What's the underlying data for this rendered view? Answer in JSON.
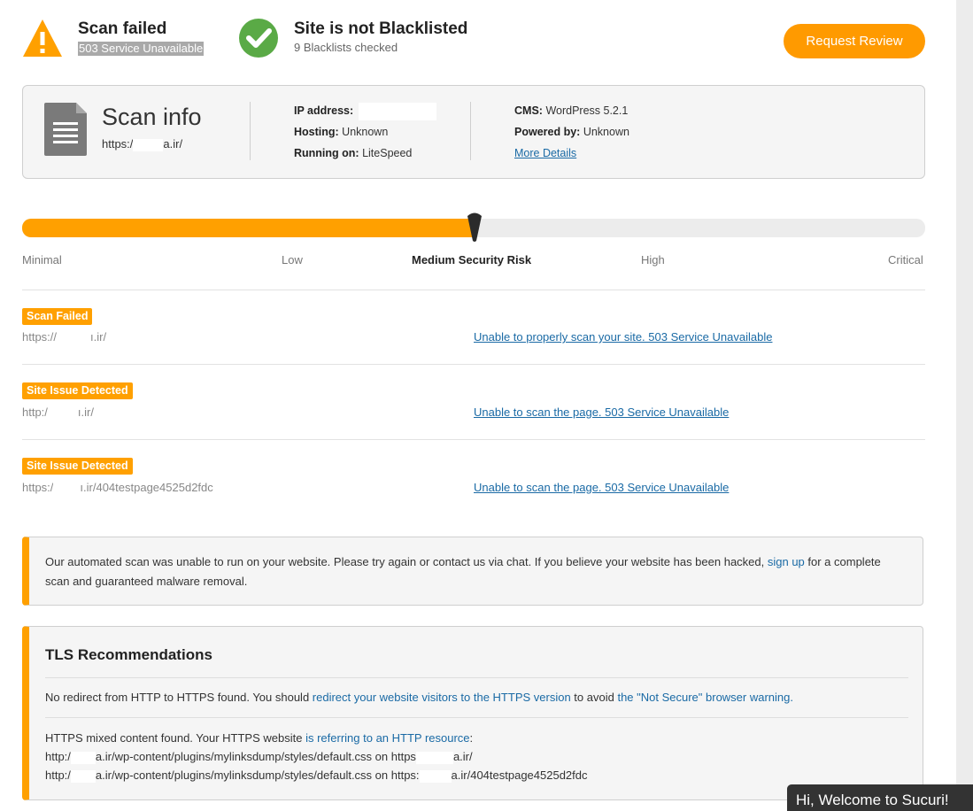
{
  "status": {
    "scan": {
      "title": "Scan failed",
      "subtitle": "503 Service Unavailable",
      "icon": "warning-icon",
      "color": "#ffa000"
    },
    "blacklist": {
      "title": "Site is not Blacklisted",
      "subtitle": "9 Blacklists checked",
      "icon": "check-circle-icon",
      "color": "#5aaa46"
    },
    "request_review": "Request Review"
  },
  "scan_info": {
    "title": "Scan info",
    "url_prefix": "https:/",
    "url_suffix": "a.ir/",
    "ip_label": "IP address:",
    "ip_value": "",
    "hosting_label": "Hosting:",
    "hosting_value": "Unknown",
    "running_label": "Running on:",
    "running_value": "LiteSpeed",
    "cms_label": "CMS:",
    "cms_value": "WordPress 5.2.1",
    "powered_label": "Powered by:",
    "powered_value": "Unknown",
    "more_details": "More Details"
  },
  "risk": {
    "level": 0.5,
    "labels": [
      "Minimal",
      "Low",
      "Medium Security Risk",
      "High",
      "Critical"
    ],
    "active_index": 2
  },
  "issues": [
    {
      "badge": "Scan Failed",
      "url_a": "https://",
      "url_b": "ı.ir/",
      "message": "Unable to properly scan your site. 503 Service Unavailable"
    },
    {
      "badge": "Site Issue Detected",
      "url_a": "http:/",
      "url_b": "ı.ir/",
      "message": "Unable to scan the page. 503 Service Unavailable"
    },
    {
      "badge": "Site Issue Detected",
      "url_a": "https:/",
      "url_b": "ı.ir/404testpage4525d2fdc",
      "message": "Unable to scan the page. 503 Service Unavailable"
    }
  ],
  "alert": {
    "text_before": "Our automated scan was unable to run on your website. Please try again or contact us via chat. If you believe your website has been hacked, ",
    "link": "sign up",
    "text_after": " for a complete scan and guaranteed malware removal."
  },
  "tls": {
    "title": "TLS Recommendations",
    "redirect": {
      "t1": "No redirect from HTTP to HTTPS found. You should ",
      "l1": "redirect your website visitors to the HTTPS version",
      "t2": " to avoid ",
      "l2": "the \"Not Secure\" browser warning."
    },
    "mixed": {
      "t1": "HTTPS mixed content found. Your HTTPS website ",
      "l1": "is referring to an HTTP resource",
      "t2": ":"
    },
    "resources": [
      {
        "a": "http:/",
        "b": "a.ir/wp-content/plugins/mylinksdump/styles/default.css on https",
        "c": "a.ir/"
      },
      {
        "a": "http:/",
        "b": "a.ir/wp-content/plugins/mylinksdump/styles/default.css on https:",
        "c": "a.ir/404testpage4525d2fdc"
      }
    ]
  },
  "chat": {
    "label": "Hi, Welcome to Sucuri!"
  }
}
